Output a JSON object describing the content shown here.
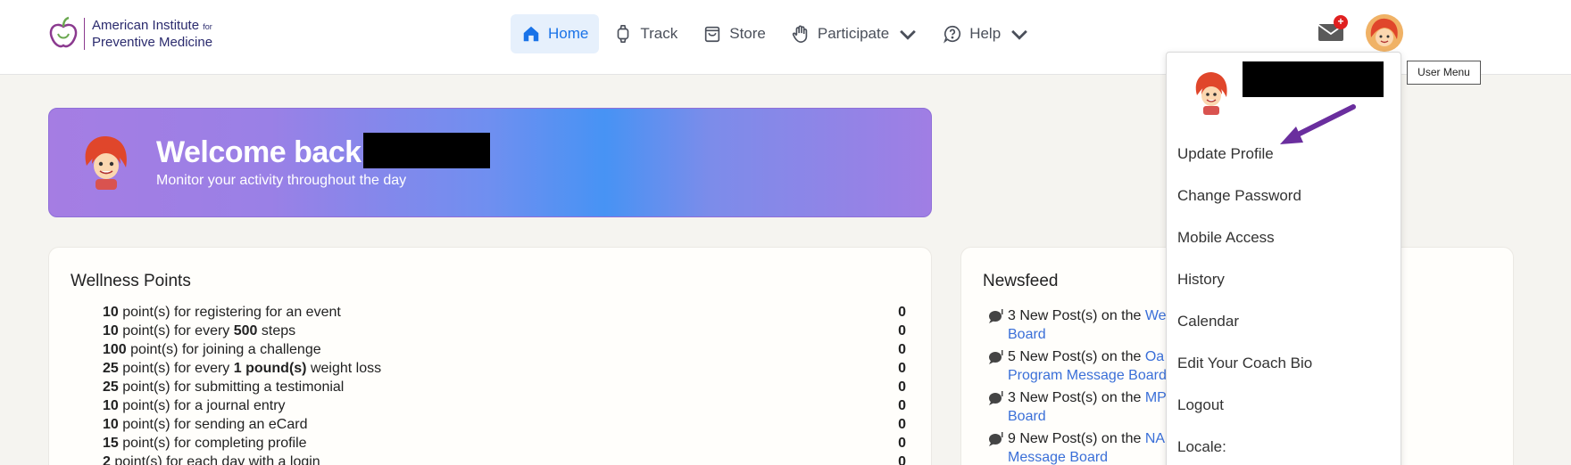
{
  "header": {
    "logo_line1": "American Institute",
    "logo_for": "for",
    "logo_line2": "Preventive Medicine",
    "nav": [
      {
        "label": "Home",
        "icon": "home-icon",
        "active": true
      },
      {
        "label": "Track",
        "icon": "watch-icon"
      },
      {
        "label": "Store",
        "icon": "bag-icon"
      },
      {
        "label": "Participate",
        "icon": "hand-icon"
      },
      {
        "label": "Help",
        "icon": "help-icon"
      }
    ],
    "mail_badge": "+"
  },
  "welcome": {
    "title": "Welcome back,",
    "subtitle": "Monitor your activity throughout the day"
  },
  "wellness": {
    "title": "Wellness Points",
    "rows": [
      {
        "pts": "10",
        "pre": "point(s) for registering for an event",
        "bold": "",
        "post": "",
        "value": "0"
      },
      {
        "pts": "10",
        "pre": "point(s) for every ",
        "bold": "500",
        "post": " steps",
        "value": "0"
      },
      {
        "pts": "100",
        "pre": "point(s) for joining a challenge",
        "bold": "",
        "post": "",
        "value": "0"
      },
      {
        "pts": "25",
        "pre": "point(s) for every ",
        "bold": "1 pound(s)",
        "post": " weight loss",
        "value": "0"
      },
      {
        "pts": "25",
        "pre": "point(s) for submitting a testimonial",
        "bold": "",
        "post": "",
        "value": "0"
      },
      {
        "pts": "10",
        "pre": "point(s) for a journal entry",
        "bold": "",
        "post": "",
        "value": "0"
      },
      {
        "pts": "10",
        "pre": "point(s) for sending an eCard",
        "bold": "",
        "post": "",
        "value": "0"
      },
      {
        "pts": "15",
        "pre": "point(s) for completing profile",
        "bold": "",
        "post": "",
        "value": "0"
      },
      {
        "pts": "2",
        "pre": "point(s) for each day with a login",
        "bold": "",
        "post": "",
        "value": "0"
      }
    ]
  },
  "newsfeed": {
    "title": "Newsfeed",
    "items": [
      {
        "text": "3 New Post(s) on the ",
        "link": "We",
        "link2": "Board"
      },
      {
        "text": "5 New Post(s) on the ",
        "link": "Oa",
        "link2": "Program Message Board"
      },
      {
        "text": "3 New Post(s) on the ",
        "link": "MP",
        "link2": "Board"
      },
      {
        "text": "9 New Post(s) on the ",
        "link": "NA",
        "link2": "Message Board"
      }
    ]
  },
  "user_menu": {
    "tooltip": "User Menu",
    "items": [
      "Update Profile",
      "Change Password",
      "Mobile Access",
      "History",
      "Calendar",
      "Edit Your Coach Bio",
      "Logout",
      "Locale:"
    ]
  },
  "colors": {
    "accent": "#1a73e8",
    "annotation_arrow": "#6a2e9e",
    "badge": "#e02020"
  }
}
